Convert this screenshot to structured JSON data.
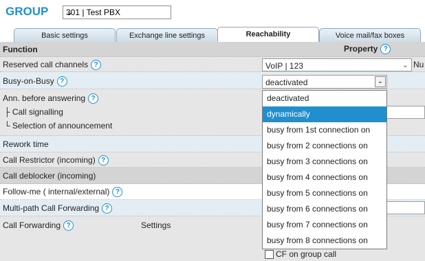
{
  "header": {
    "group_label": "GROUP",
    "group_value": "301 | Test PBX"
  },
  "tabs": [
    {
      "label": "Basic settings",
      "active": false
    },
    {
      "label": "Exchange line settings",
      "active": false
    },
    {
      "label": "Reachability",
      "active": true
    },
    {
      "label": "Voice mail/fax boxes",
      "active": false
    }
  ],
  "table": {
    "header_function": "Function",
    "header_property": "Property",
    "rows": [
      {
        "label": "Reserved call channels",
        "help": "?"
      },
      {
        "label": "Busy-on-Busy",
        "help": "?"
      },
      {
        "label": "Ann. before answering",
        "help": "?"
      },
      {
        "label": "├ Call signalling"
      },
      {
        "label": "└ Selection of announcement"
      },
      {
        "label": "Rework time"
      },
      {
        "label": "Call Restrictor (incoming)",
        "help": "?"
      },
      {
        "label": "Call deblocker (incoming)"
      },
      {
        "label": "Follow-me ( internal/external)",
        "help": "?"
      },
      {
        "label": "Multi-path Call Forwarding",
        "help": "?"
      },
      {
        "label": "Call Forwarding",
        "help": "?",
        "extra": "Settings"
      }
    ]
  },
  "reserved_call_channels_value": "VoIP | 123",
  "reserved_call_channels_suffix": "Nu",
  "busy_on_busy": {
    "value": "deactivated",
    "options": [
      "deactivated",
      "dynamically",
      "busy from 1st connection on",
      "busy from 2 connections on",
      "busy from 3 connections on",
      "busy from 4 connections on",
      "busy from 5 connections on",
      "busy from 6 connections on",
      "busy from 7 connections on",
      "busy from 8 connections on"
    ],
    "highlighted": "dynamically"
  },
  "cf_group_call_label": "CF on group call",
  "icons": {
    "help": "question-circle-icon",
    "dropdown": "chevron-down-icon"
  },
  "colors": {
    "accent": "#1f8fd0",
    "header_bg": "#d4d4d4"
  }
}
